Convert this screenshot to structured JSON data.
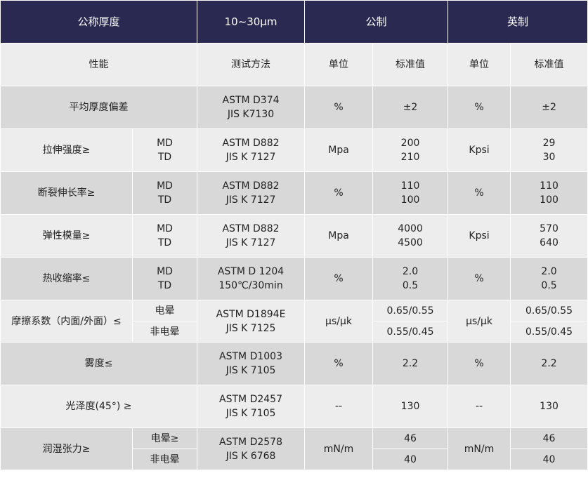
{
  "header": {
    "title": "公称厚度",
    "thickness": "10~30μm",
    "metric": "公制",
    "imperial": "英制"
  },
  "subheader": {
    "property": "性能",
    "test_method": "测试方法",
    "unit": "单位",
    "standard": "标准值",
    "unit2": "单位",
    "standard2": "标准值"
  },
  "rows": {
    "avg_thickness": {
      "name": "平均厚度偏差",
      "method1": "ASTM D374",
      "method2": "JIS K7130",
      "unit_m": "%",
      "value_m": "±2",
      "unit_i": "%",
      "value_i": "±2"
    },
    "tensile": {
      "name": "拉伸强度≥",
      "dir1": "MD",
      "dir2": "TD",
      "method1": "ASTM D882",
      "method2": "JIS K 7127",
      "unit_m": "Mpa",
      "value_m1": "200",
      "value_m2": "210",
      "unit_i": "Kpsi",
      "value_i1": "29",
      "value_i2": "30"
    },
    "elongation": {
      "name": "断裂伸长率≥",
      "dir1": "MD",
      "dir2": "TD",
      "method1": "ASTM D882",
      "method2": "JIS K 7127",
      "unit_m": "%",
      "value_m1": "110",
      "value_m2": "100",
      "unit_i": "%",
      "value_i1": "110",
      "value_i2": "100"
    },
    "modulus": {
      "name": "弹性模量≥",
      "dir1": "MD",
      "dir2": "TD",
      "method1": "ASTM D882",
      "method2": "JIS K 7127",
      "unit_m": "Mpa",
      "value_m1": "4000",
      "value_m2": "4500",
      "unit_i": "Kpsi",
      "value_i1": "570",
      "value_i2": "640"
    },
    "shrinkage": {
      "name": "热收缩率≤",
      "dir1": "MD",
      "dir2": "TD",
      "method1": "ASTM D 1204",
      "method2": "150℃/30min",
      "unit_m": "%",
      "value_m1": "2.0",
      "value_m2": "0.5",
      "unit_i": "%",
      "value_i1": "2.0",
      "value_i2": "0.5"
    },
    "friction": {
      "name": "摩擦系数（内面/外面）≤",
      "sub1": "电晕",
      "sub2": "非电晕",
      "method1": "ASTM D1894E",
      "method2": "JIS K 7125",
      "unit_m": "μs/μk",
      "value_m1": "0.65/0.55",
      "value_m2": "0.55/0.45",
      "unit_i": "μs/μk",
      "value_i1": "0.65/0.55",
      "value_i2": "0.55/0.45"
    },
    "haze": {
      "name": "雾度≤",
      "method1": "ASTM D1003",
      "method2": "JIS K 7105",
      "unit_m": "%",
      "value_m": "2.2",
      "unit_i": "%",
      "value_i": "2.2"
    },
    "gloss": {
      "name": "光泽度(45°) ≥",
      "method1": "ASTM D2457",
      "method2": "JIS K 7105",
      "unit_m": "--",
      "value_m": "130",
      "unit_i": "--",
      "value_i": "130"
    },
    "wetting": {
      "name": "润湿张力≥",
      "sub1": "电晕≥",
      "sub2": "非电晕",
      "method1": "ASTM D2578",
      "method2": "JIS K 6768",
      "unit_m": "mN/m",
      "value_m1": "46",
      "value_m2": "40",
      "unit_i": "mN/m",
      "value_i1": "46",
      "value_i2": "40"
    }
  }
}
